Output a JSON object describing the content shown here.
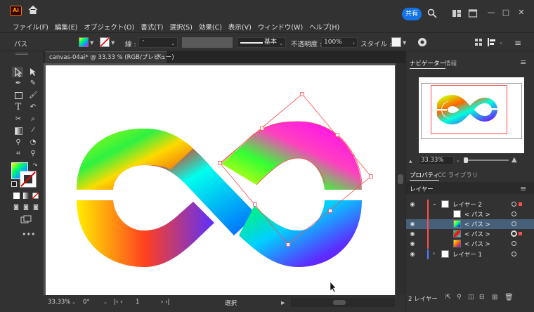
{
  "titlebar": {
    "app_logo": "Ai",
    "share_label": "共有",
    "icons": [
      "home-icon",
      "search-icon",
      "arrange-documents-icon",
      "window-icon"
    ],
    "window_controls": [
      "—",
      "□",
      "✕"
    ]
  },
  "menu": [
    "ファイル(F)",
    "編集(E)",
    "オブジェクト(O)",
    "書式(T)",
    "選択(S)",
    "効果(C)",
    "表示(V)",
    "ウィンドウ(W)",
    "ヘルプ(H)"
  ],
  "control_bar": {
    "object_type": "パス",
    "stroke_label": "線 :",
    "brush_label": "基本",
    "opacity_label": "不透明度 :",
    "opacity_value": "100%",
    "style_label": "スタイル :"
  },
  "document": {
    "tab_title": "canvas-04ai* @ 33.33 % (RGB/プレビュー)",
    "tab_close": "×"
  },
  "status_bar": {
    "zoom": "33.33%",
    "rotation": "0°",
    "artboard": "1",
    "tool": "選択"
  },
  "panels": {
    "navigator_tab": "ナビゲーター",
    "info_tab": "情報",
    "navigator_zoom": "33.33%",
    "properties_tab": "プロパティ",
    "libraries_tab": "CC ライブラリ",
    "layers_tab": "レイヤー",
    "layer_count": "2 レイヤー"
  },
  "layers": [
    {
      "label": "レイヤー 2",
      "type": "layer",
      "visible": true,
      "expanded": true,
      "color": "#ff4f4f"
    },
    {
      "label": "< パス >",
      "type": "path",
      "visible": false,
      "selected": false
    },
    {
      "label": "< パス >",
      "type": "path",
      "visible": true,
      "selected": true
    },
    {
      "label": "< パス >",
      "type": "path",
      "visible": true,
      "selected": false,
      "targeted": true
    },
    {
      "label": "< パス >",
      "type": "path",
      "visible": true,
      "selected": false
    },
    {
      "label": "レイヤー 1",
      "type": "layer",
      "visible": true,
      "expanded": false,
      "color": "#4f7fff"
    }
  ],
  "colors": {
    "accent": "#1473e6",
    "selection": "#ff4b4b",
    "layer2_color": "#ff4f4f",
    "layer1_color": "#4f7fff"
  }
}
